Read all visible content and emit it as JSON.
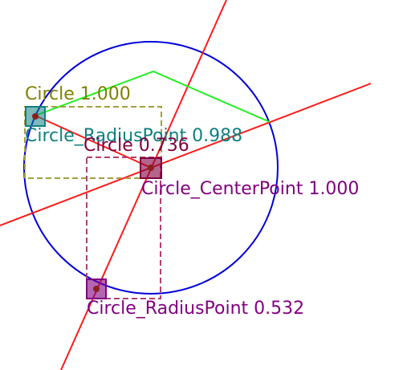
{
  "diagram": {
    "labels": {
      "circle": "Circle 1.000",
      "radius_point_1": "Circle_RadiusPoint 0.988",
      "circle_2": "Circle 0.736",
      "center_point": "Circle_CenterPoint 1.000",
      "radius_point_2": "Circle_RadiusPoint 0.532"
    },
    "colors": {
      "circle_outline": "#0000dd",
      "lines": "#ff1a1a",
      "polyline": "#22ee22",
      "circle_label": "#808000",
      "radius_point_1": "#108080",
      "circle_2": "#800040",
      "center_point": "#800080",
      "radius_point_2": "#800080"
    }
  }
}
